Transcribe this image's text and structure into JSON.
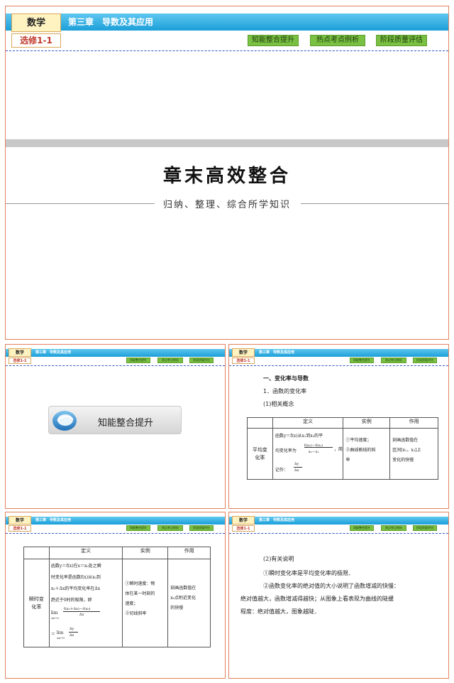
{
  "header": {
    "subject": "数学",
    "edition": "选修1-1",
    "chapter": "第三章　导数及其应用",
    "nav": [
      "知能整合提升",
      "热点考点例析",
      "阶段质量评估"
    ]
  },
  "cover": {
    "title": "章末高效整合",
    "subtitle": "归纳、整理、综合所学知识"
  },
  "thumb_a": {
    "badge_label": "知能整合提升"
  },
  "thumb_b": {
    "section": "一、变化率与导数",
    "sub1": "1．函数的变化率",
    "sub2": "(1)相关概念",
    "table_headers": [
      "定义",
      "实例",
      "作用"
    ],
    "row_label": [
      "平均变",
      "化率"
    ],
    "def_lines": [
      "函数y＝f(x)从x₁到x₂的平",
      "均变化率为",
      "，简",
      "记作："
    ],
    "formula_num": "f(x₂)－f(x₁)",
    "formula_den": "x₂－x₁",
    "short_num": "Δy",
    "short_den": "Δx",
    "example_lines": [
      "①平均速度；",
      "②曲线割线的斜",
      "率"
    ],
    "use_lines": [
      "刻画函数值在",
      "区间[x₁，x₂]上",
      "变化的快慢"
    ]
  },
  "thumb_c": {
    "table_headers": [
      "定义",
      "实例",
      "作用"
    ],
    "row_label": [
      "瞬时变",
      "化率"
    ],
    "def_lines": [
      "函数y＝f(x)在x＝x₀处之瞬",
      "时变化率是函数f(x)从x₀到",
      "x₀＋Δx的平均变化率在Δx",
      "趋近于0时的极限，即"
    ],
    "lim_label": "lim",
    "lim_sub": "Δx→0",
    "lim_num": "f(x₀＋Δx)－f(x₀)",
    "lim_den": "Δx",
    "eq_prefix": "＝",
    "lim_num2": "Δy",
    "lim_den2": "Δx",
    "example_lines": [
      "①瞬时速度：物",
      "体在某一时刻的",
      "速度；",
      "②切线斜率"
    ],
    "use_lines": [
      "刻画函数值在",
      "x₀点附近变化",
      "的快慢"
    ]
  },
  "thumb_d": {
    "heading": "(2)有关说明",
    "p1": "①瞬时变化率是平均变化率的极限．",
    "p2_lines": [
      "②函数变化率的绝对值的大小说明了函数增减的快慢：",
      "绝对值越大，函数增减得越快；从图象上看表现为曲线的陡缓",
      "程度：绝对值越大，图象越陡．"
    ]
  }
}
